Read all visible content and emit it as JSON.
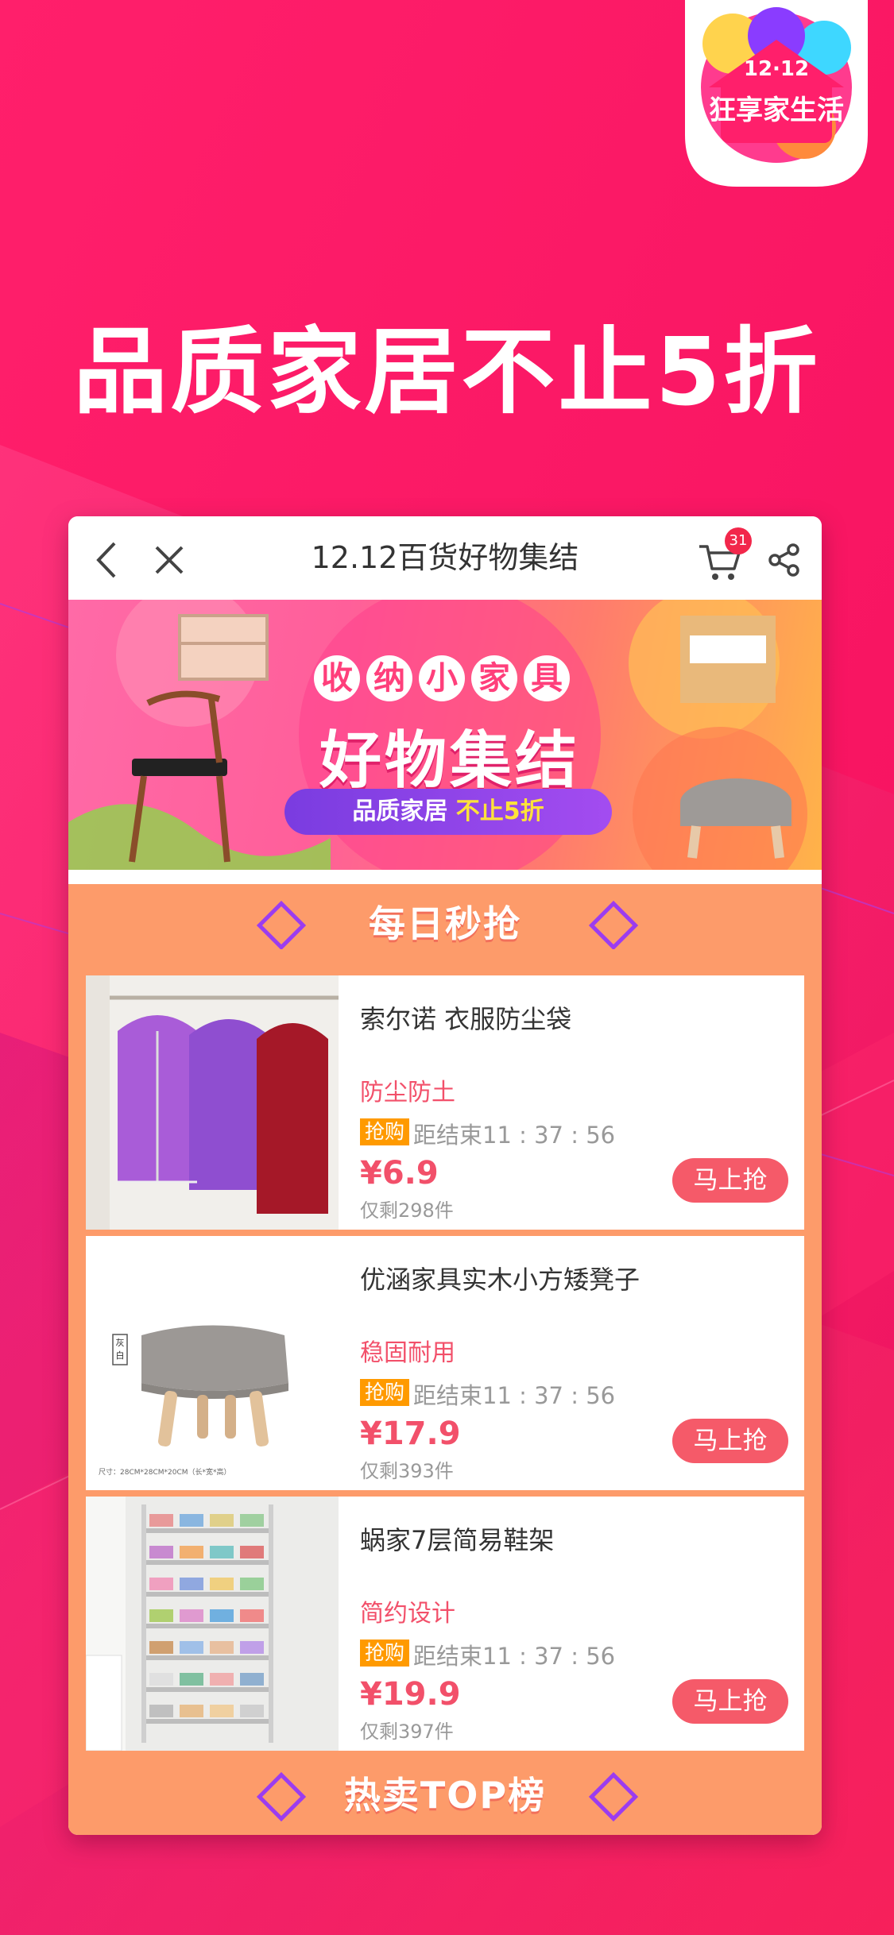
{
  "promo": {
    "headline": "品质家居不止5折",
    "badge_top": "12·12",
    "badge_bottom": "狂享家生活"
  },
  "app": {
    "title": "12.12百货好物集结",
    "cart_count": "31",
    "icons": [
      "back-icon",
      "close-icon",
      "cart-icon",
      "share-icon"
    ]
  },
  "hero": {
    "subtitle": [
      "收",
      "纳",
      "小",
      "家",
      "具"
    ],
    "title": "好物集结",
    "pill_text": "品质家居",
    "pill_highlight": "不止5折"
  },
  "sections": {
    "daily": "每日秒抢",
    "top": "热卖TOP榜"
  },
  "products": [
    {
      "name": "索尔诺 衣服防尘袋",
      "tag": "防尘防土",
      "flash_label": "抢购",
      "countdown": "距结束11 : 37 : 56",
      "price": "¥6.9",
      "stock": "仅剩298件",
      "button": "马上抢"
    },
    {
      "name": "优涵家具实木小方矮凳子",
      "tag": "稳固耐用",
      "flash_label": "抢购",
      "countdown": "距结束11 : 37 : 56",
      "price": "¥17.9",
      "stock": "仅剩393件",
      "button": "马上抢",
      "img_note_color": "灰白",
      "img_note_size": "尺寸：28CM*28CM*20CM（长*宽*高）"
    },
    {
      "name": "蜗家7层简易鞋架",
      "tag": "简约设计",
      "flash_label": "抢购",
      "countdown": "距结束11 : 37 : 56",
      "price": "¥19.9",
      "stock": "仅剩397件",
      "button": "马上抢"
    }
  ],
  "colors": {
    "background": "#f81a68",
    "section": "#fd9b6a",
    "accent": "#f2506a",
    "button": "#f55a69",
    "flash": "#ff9a00"
  }
}
